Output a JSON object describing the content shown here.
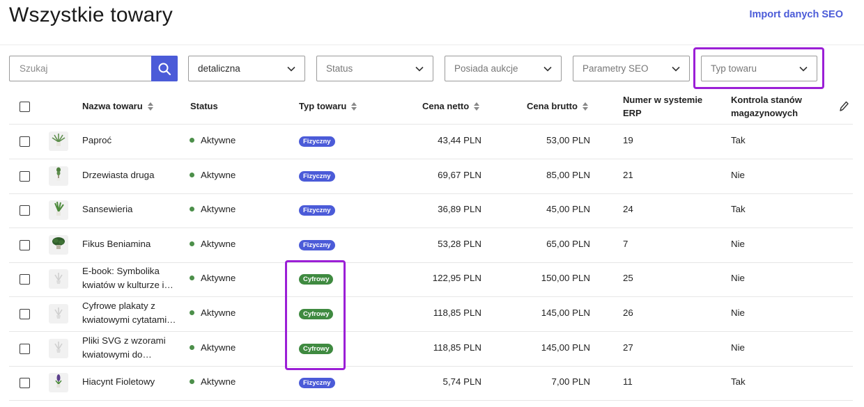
{
  "header": {
    "title": "Wszystkie towary",
    "import_link": "Import danych SEO"
  },
  "filters": {
    "search_placeholder": "Szukaj",
    "price_type": "detaliczna",
    "status": "Status",
    "has_auctions": "Posiada aukcje",
    "seo_params": "Parametry SEO",
    "product_type": "Typ towaru"
  },
  "table": {
    "columns": {
      "name": "Nazwa towaru",
      "status": "Status",
      "type": "Typ towaru",
      "net_price": "Cena netto",
      "gross_price": "Cena brutto",
      "erp_line1": "Numer w systemie",
      "erp_line2": "ERP",
      "stock_line1": "Kontrola stanów",
      "stock_line2": "magazynowych"
    },
    "rows": [
      {
        "name_line1": "Paproć",
        "name_line2": "",
        "status": "Aktywne",
        "type": "Fizyczny",
        "type_color": "#4b5bd8",
        "net": "43,44 PLN",
        "gross": "53,00 PLN",
        "erp": "19",
        "stock": "Tak",
        "thumb_icon": "fern-plant-icon"
      },
      {
        "name_line1": "Drzewiasta druga",
        "name_line2": "",
        "status": "Aktywne",
        "type": "Fizyczny",
        "type_color": "#4b5bd8",
        "net": "69,67 PLN",
        "gross": "85,00 PLN",
        "erp": "21",
        "stock": "Nie",
        "thumb_icon": "tree-plant-icon"
      },
      {
        "name_line1": "Sansewieria",
        "name_line2": "",
        "status": "Aktywne",
        "type": "Fizyczny",
        "type_color": "#4b5bd8",
        "net": "36,89 PLN",
        "gross": "45,00 PLN",
        "erp": "24",
        "stock": "Tak",
        "thumb_icon": "snake-plant-icon"
      },
      {
        "name_line1": "Fikus Beniamina",
        "name_line2": "",
        "status": "Aktywne",
        "type": "Fizyczny",
        "type_color": "#4b5bd8",
        "net": "53,28 PLN",
        "gross": "65,00 PLN",
        "erp": "7",
        "stock": "Nie",
        "thumb_icon": "ficus-plant-icon"
      },
      {
        "name_line1": "E-book: Symbolika",
        "name_line2": "kwiatów w kulturze i…",
        "status": "Aktywne",
        "type": "Cyfrowy",
        "type_color": "#3f8a40",
        "net": "122,95 PLN",
        "gross": "150,00 PLN",
        "erp": "25",
        "stock": "Nie",
        "thumb_icon": "placeholder-plant-icon"
      },
      {
        "name_line1": "Cyfrowe plakaty z",
        "name_line2": "kwiatowymi cytatami…",
        "status": "Aktywne",
        "type": "Cyfrowy",
        "type_color": "#3f8a40",
        "net": "118,85 PLN",
        "gross": "145,00 PLN",
        "erp": "26",
        "stock": "Nie",
        "thumb_icon": "placeholder-plant-icon"
      },
      {
        "name_line1": "Pliki SVG z wzorami",
        "name_line2": "kwiatowymi do…",
        "status": "Aktywne",
        "type": "Cyfrowy",
        "type_color": "#3f8a40",
        "net": "118,85 PLN",
        "gross": "145,00 PLN",
        "erp": "27",
        "stock": "Nie",
        "thumb_icon": "placeholder-plant-icon"
      },
      {
        "name_line1": "Hiacynt Fioletowy",
        "name_line2": "",
        "status": "Aktywne",
        "type": "Fizyczny",
        "type_color": "#4b5bd8",
        "net": "5,74 PLN",
        "gross": "7,00 PLN",
        "erp": "11",
        "stock": "Tak",
        "thumb_icon": "hyacinth-plant-icon"
      }
    ]
  },
  "colors": {
    "accent": "#4b5bd8",
    "highlight": "#9b1fd6",
    "active_dot": "#4c8f4a"
  }
}
